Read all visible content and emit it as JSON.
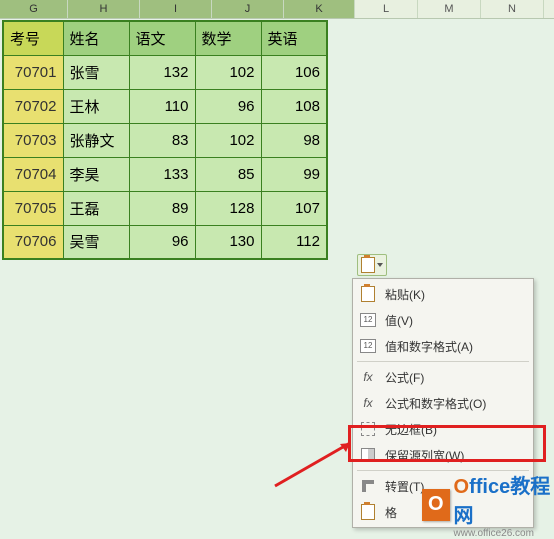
{
  "columns": [
    "G",
    "H",
    "I",
    "J",
    "K",
    "L",
    "M",
    "N"
  ],
  "table": {
    "headers": [
      "考号",
      "姓名",
      "语文",
      "数学",
      "英语"
    ],
    "rows": [
      {
        "id": "70701",
        "name": "张雪",
        "c1": 132,
        "c2": 102,
        "c3": 106
      },
      {
        "id": "70702",
        "name": "王林",
        "c1": 110,
        "c2": 96,
        "c3": 108
      },
      {
        "id": "70703",
        "name": "张静文",
        "c1": 83,
        "c2": 102,
        "c3": 98
      },
      {
        "id": "70704",
        "name": "李昊",
        "c1": 133,
        "c2": 85,
        "c3": 99
      },
      {
        "id": "70705",
        "name": "王磊",
        "c1": 89,
        "c2": 128,
        "c3": 107
      },
      {
        "id": "70706",
        "name": "吴雪",
        "c1": 96,
        "c2": 130,
        "c3": 112
      }
    ]
  },
  "menu": {
    "paste": "粘贴(K)",
    "values": "值(V)",
    "values_fmt": "值和数字格式(A)",
    "formula": "公式(F)",
    "formula_fmt": "公式和数字格式(O)",
    "noborder": "无边框(B)",
    "keepwidth": "保留源列宽(W)",
    "transpose": "转置(T)",
    "fmt": "格"
  },
  "logo": {
    "badge": "O",
    "main_prefix": "O",
    "main_rest": "ffice",
    "suffix": "教程网",
    "url": "www.office26.com"
  }
}
